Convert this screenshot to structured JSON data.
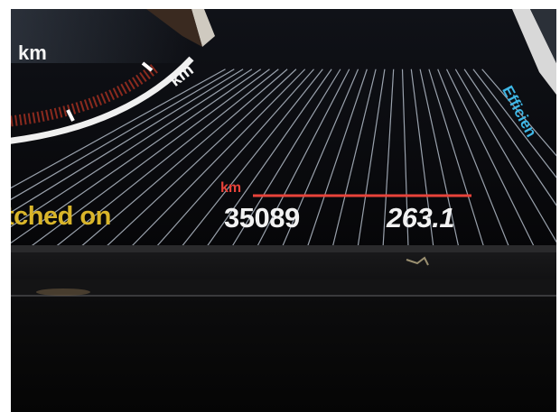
{
  "cluster": {
    "status_text": "tched on",
    "unit_label_left": "km",
    "unit_label_dial": "km",
    "unit_label_red": "km",
    "odometer": "35089",
    "trip": "263.1",
    "efficiency_label": "Efficien"
  },
  "colors": {
    "status_yellow": "#d9b52a",
    "value_white": "#f2f2f2",
    "accent_red": "#e8433a",
    "efficiency_blue": "#3fb7e6",
    "display_black": "#0b0b0e"
  }
}
